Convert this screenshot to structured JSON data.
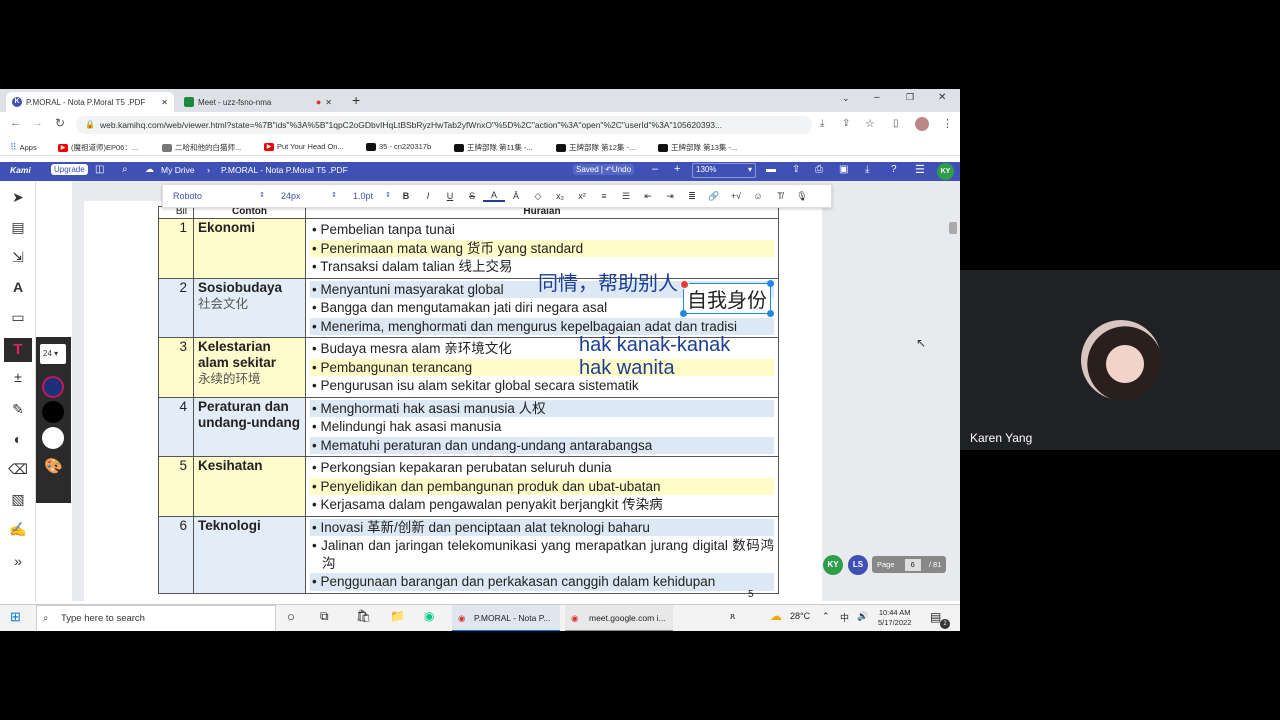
{
  "browser": {
    "tabs": [
      {
        "label": "P.MORAL - Nota P.Moral T5 .PDF"
      },
      {
        "label": "Meet - uzz-fsno-nma"
      }
    ],
    "url": "web.kamihq.com/web/viewer.html?state=%7B\"ids\"%3A%5B\"1qpC2oGDbvIHqLtBSbRyzHwTab2yfWnxO\"%5D%2C\"action\"%3A\"open\"%2C\"userId\"%3A\"105620393...",
    "bookmarks": [
      "Apps",
      "(魔祖道师)EP06：...",
      "二哈和他的白猫师...",
      "Put Your Head On...",
      "35 - cn220317b",
      "王牌部隊 第11集 -...",
      "王牌部隊 第12集 -...",
      "王牌部隊 第13集 -..."
    ]
  },
  "kami": {
    "logo": "Kami",
    "upgrade": "Upgrade",
    "my_drive": "My Drive",
    "doc_title": "P.MORAL - Nota P.Moral T5 .PDF",
    "saved": "Saved",
    "undo": "Undo",
    "zoom": "130%",
    "user_initials": "KY"
  },
  "format": {
    "font": "Roboto",
    "size": "24px",
    "line": "1.0pt"
  },
  "palette": {
    "size": "24"
  },
  "table": {
    "header_cut": [
      "Bil",
      "Contoh",
      "Huraian"
    ],
    "rows": [
      {
        "num": "1",
        "topic": "Ekonomi",
        "topic_zh": "",
        "items": [
          "Pembelian tanpa tunai",
          "Penerimaan mata wang 货币 yang standard",
          "Transaksi dalam talian 线上交易"
        ]
      },
      {
        "num": "2",
        "topic": "Sosiobudaya",
        "topic_zh": "社会文化",
        "items": [
          "Menyantuni masyarakat global",
          "Bangga dan mengutamakan jati diri negara asal",
          "Menerima, menghormati dan mengurus kepelbagaian adat dan tradisi"
        ]
      },
      {
        "num": "3",
        "topic": "Kelestarian alam sekitar",
        "topic_zh": "永续的环境",
        "items": [
          "Budaya mesra alam 亲环境文化",
          "Pembangunan terancang",
          "Pengurusan isu alam sekitar global secara sistematik"
        ]
      },
      {
        "num": "4",
        "topic": "Peraturan dan undang-undang",
        "topic_zh": "",
        "items": [
          "Menghormati hak asasi manusia 人权",
          "Melindungi hak asasi manusia",
          "Mematuhi peraturan dan undang-undang antarabangsa"
        ]
      },
      {
        "num": "5",
        "topic": "Kesihatan",
        "topic_zh": "",
        "items": [
          "Perkongsian kepakaran perubatan seluruh dunia",
          "Penyelidikan dan pembangunan produk dan ubat-ubatan",
          "Kerjasama dalam pengawalan penyakit berjangkit 传染病"
        ]
      },
      {
        "num": "6",
        "topic": "Teknologi",
        "topic_zh": "",
        "items": [
          "Inovasi 革新/创新 dan penciptaan alat teknologi baharu",
          "Jalinan dan jaringan telekomunikasi yang merapatkan jurang digital 数码鸿沟",
          "Penggunaan barangan dan perkakasan canggih dalam kehidupan"
        ]
      }
    ]
  },
  "annotations": {
    "a1": "同情，帮助别人",
    "a2": "自我身份",
    "a3": "hak kanak-kanak",
    "a4": "hak wanita"
  },
  "page_number": "5",
  "pager": {
    "label": "Page",
    "current": "6",
    "total": "/ 81"
  },
  "collaborators": [
    "KY",
    "LS"
  ],
  "taskbar": {
    "search": "Type here to search",
    "app1": "P.MORAL - Nota P...",
    "app2": "meet.google.com i...",
    "temp": "28°C",
    "lang": "中",
    "time": "10:44 AM",
    "date": "5/17/2022",
    "notif": "2"
  },
  "meet": {
    "participant": "Karen Yang"
  }
}
